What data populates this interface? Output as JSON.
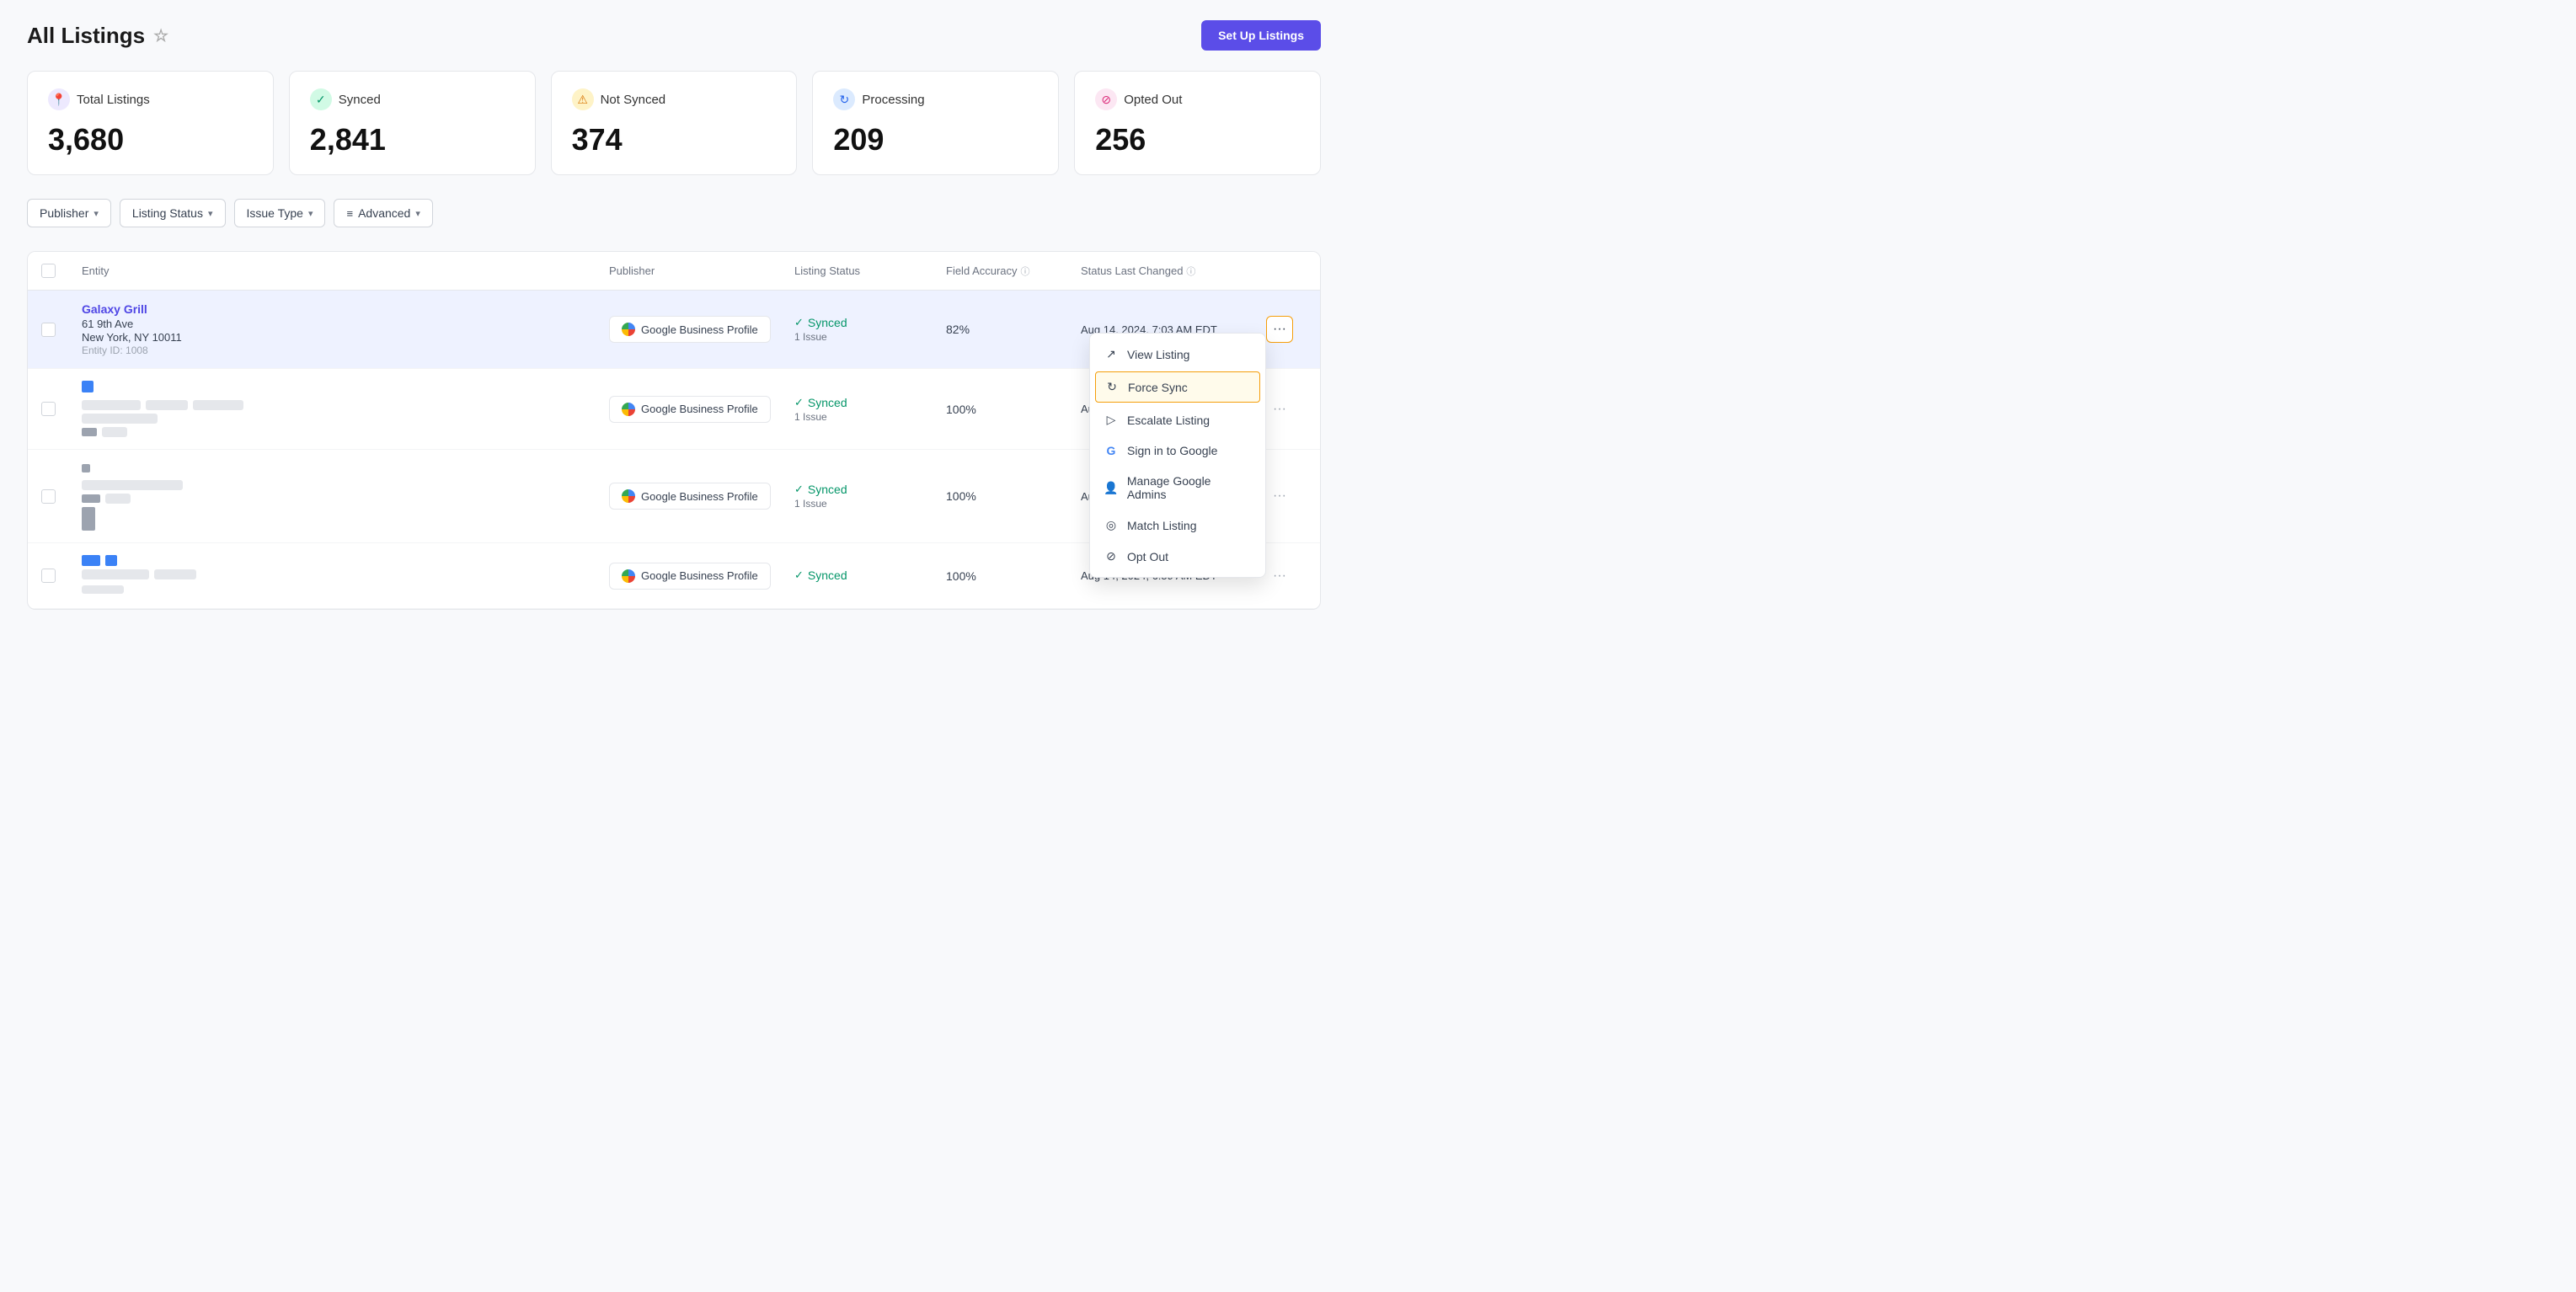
{
  "page": {
    "title": "All Listings",
    "setup_button": "Set Up Listings"
  },
  "stats": [
    {
      "id": "total",
      "icon_type": "purple",
      "icon": "📍",
      "label": "Total Listings",
      "value": "3,680"
    },
    {
      "id": "synced",
      "icon_type": "green",
      "icon": "✓",
      "label": "Synced",
      "value": "2,841"
    },
    {
      "id": "not_synced",
      "icon_type": "yellow",
      "icon": "⚠",
      "label": "Not Synced",
      "value": "374"
    },
    {
      "id": "processing",
      "icon_type": "blue",
      "icon": "↻",
      "label": "Processing",
      "value": "209"
    },
    {
      "id": "opted_out",
      "icon_type": "pink",
      "icon": "⊘",
      "label": "Opted Out",
      "value": "256"
    }
  ],
  "filters": [
    {
      "id": "publisher",
      "label": "Publisher"
    },
    {
      "id": "listing_status",
      "label": "Listing Status"
    },
    {
      "id": "issue_type",
      "label": "Issue Type"
    },
    {
      "id": "advanced",
      "label": "Advanced",
      "has_icon": true
    }
  ],
  "table": {
    "headers": [
      {
        "id": "checkbox",
        "label": ""
      },
      {
        "id": "entity",
        "label": "Entity"
      },
      {
        "id": "publisher",
        "label": "Publisher"
      },
      {
        "id": "listing_status",
        "label": "Listing Status"
      },
      {
        "id": "field_accuracy",
        "label": "Field Accuracy",
        "has_info": true
      },
      {
        "id": "status_last_changed",
        "label": "Status Last Changed",
        "has_info": true
      },
      {
        "id": "actions",
        "label": ""
      }
    ],
    "rows": [
      {
        "id": 1,
        "highlighted": true,
        "entity_name": "Galaxy Grill",
        "entity_address": "61 9th Ave",
        "entity_city": "New York, NY 10011",
        "entity_id": "Entity ID: 1008",
        "is_blurred": false,
        "publisher": "Google Business Profile",
        "status": "Synced",
        "status_detail": "1 Issue",
        "accuracy": "82%",
        "date": "Aug 14, 2024, 7:03 AM EDT",
        "show_dropdown": true
      },
      {
        "id": 2,
        "highlighted": false,
        "entity_name": "",
        "is_blurred": true,
        "publisher": "Google Business Profile",
        "status": "Synced",
        "status_detail": "1 Issue",
        "accuracy": "100%",
        "date": "Aug 14, 2024, 7:01",
        "show_dropdown": false
      },
      {
        "id": 3,
        "highlighted": false,
        "entity_name": "",
        "is_blurred": true,
        "publisher": "Google Business Profile",
        "status": "Synced",
        "status_detail": "1 Issue",
        "accuracy": "100%",
        "date": "Aug 14, 2024, 7:01",
        "show_dropdown": false
      },
      {
        "id": 4,
        "highlighted": false,
        "entity_name": "",
        "is_blurred": true,
        "publisher": "Google Business Profile",
        "status": "Synced",
        "status_detail": "",
        "accuracy": "100%",
        "date": "Aug 14, 2024, 6:59 AM EDT",
        "show_dropdown": false
      }
    ]
  },
  "dropdown": {
    "items": [
      {
        "id": "view_listing",
        "label": "View Listing",
        "icon": "↗"
      },
      {
        "id": "force_sync",
        "label": "Force Sync",
        "icon": "↻"
      },
      {
        "id": "escalate_listing",
        "label": "Escalate Listing",
        "icon": "▷"
      },
      {
        "id": "sign_in_google",
        "label": "Sign in to Google",
        "icon": "G"
      },
      {
        "id": "manage_admins",
        "label": "Manage Google Admins",
        "icon": "👤"
      },
      {
        "id": "match_listing",
        "label": "Match Listing",
        "icon": "◎"
      },
      {
        "id": "opt_out",
        "label": "Opt Out",
        "icon": "⊘"
      }
    ]
  }
}
